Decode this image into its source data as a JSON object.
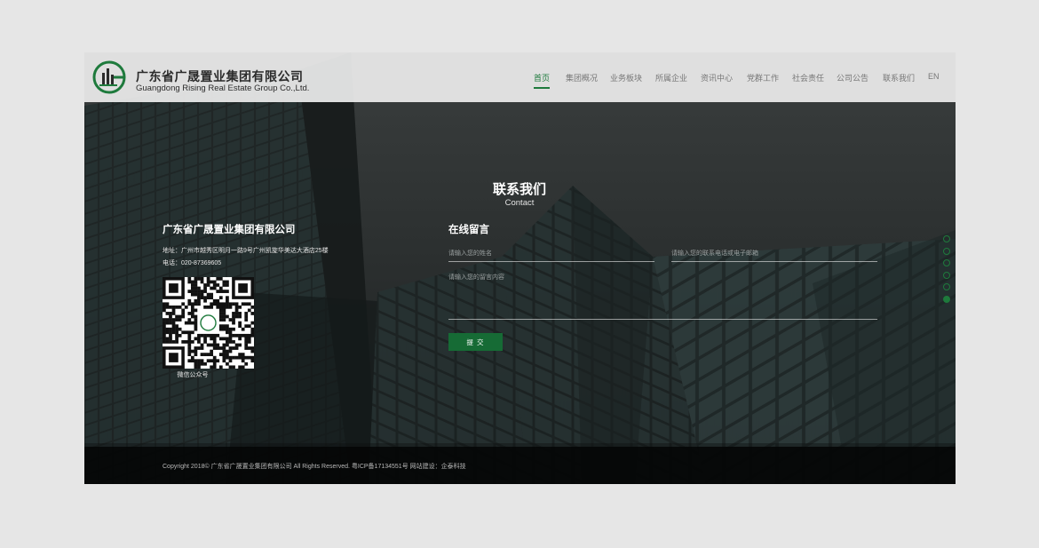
{
  "brand": {
    "name_cn": "广东省广晟置业集团有限公司",
    "name_en": "Guangdong Rising Real Estate Group Co.,Ltd.",
    "accent_color": "#1e7a3c",
    "logo_icon": "company-logo-icon"
  },
  "nav": {
    "items": [
      {
        "label": "首页",
        "active": true
      },
      {
        "label": "集团概况",
        "active": false
      },
      {
        "label": "业务板块",
        "active": false
      },
      {
        "label": "所属企业",
        "active": false
      },
      {
        "label": "资讯中心",
        "active": false
      },
      {
        "label": "党群工作",
        "active": false
      },
      {
        "label": "社会责任",
        "active": false
      },
      {
        "label": "公司公告",
        "active": false
      },
      {
        "label": "联系我们",
        "active": false
      },
      {
        "label": "EN",
        "active": false
      }
    ]
  },
  "section": {
    "title_cn": "联系我们",
    "title_en": "Contact"
  },
  "contact": {
    "company": "广东省广晟置业集团有限公司",
    "address": "地址：广州市越秀区明月一路9号广州凯旋华美达大酒店25楼",
    "phone": "电话：020-87369605",
    "qr_caption": "微信公众号",
    "qr_icon": "qr-code-icon"
  },
  "message_form": {
    "title": "在线留言",
    "name_placeholder": "请输入您的姓名",
    "contact_placeholder": "请输入您的联系电话或电子邮箱",
    "message_placeholder": "请输入您的留言内容",
    "submit_label": "提 交"
  },
  "side_nav": {
    "dot_count": 6,
    "active_index": 5
  },
  "footer": {
    "copyright": "Copyright 2018© 广东省广晟置业集团有限公司 All Rights Reserved. 粤ICP备17134551号 网站建设：企泰科技"
  }
}
